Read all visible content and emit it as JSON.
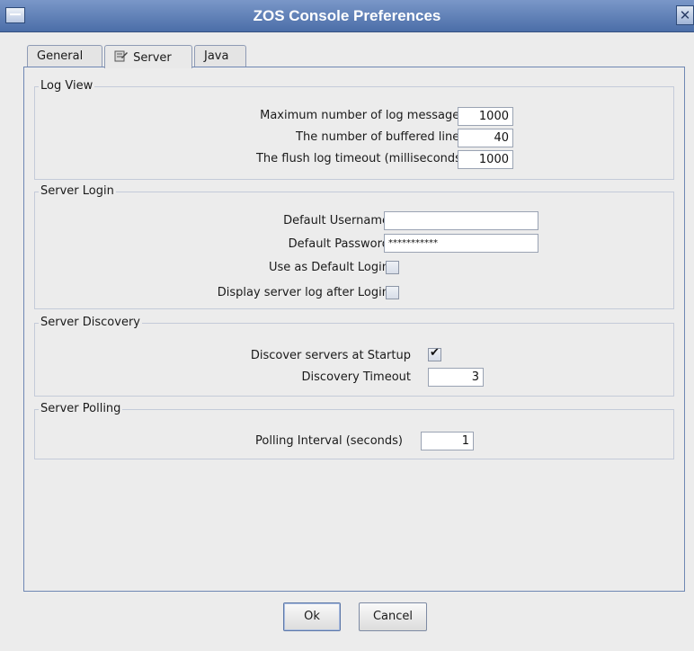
{
  "window": {
    "title": "ZOS Console Preferences",
    "close_glyph": "✕",
    "menu_icon": "window-menu-icon"
  },
  "tabs": [
    {
      "label": "General",
      "active": false
    },
    {
      "label": "Server",
      "active": true,
      "icon": "server-tab-icon"
    },
    {
      "label": "Java",
      "active": false
    }
  ],
  "log_view": {
    "title": "Log View",
    "max_messages_label": "Maximum number of log messages",
    "max_messages_value": "1000",
    "buffered_lines_label": "The number of buffered lines",
    "buffered_lines_value": "40",
    "flush_timeout_label": "The flush log timeout (milliseconds)",
    "flush_timeout_value": "1000"
  },
  "server_login": {
    "title": "Server Login",
    "username_label": "Default Username",
    "username_value": "",
    "password_label": "Default Password",
    "password_value": "***********",
    "default_login_label": "Use as Default Login",
    "default_login_checked": false,
    "display_log_label": "Display server log after Login",
    "display_log_checked": false
  },
  "server_discovery": {
    "title": "Server Discovery",
    "discover_startup_label": "Discover servers at Startup",
    "discover_startup_checked": true,
    "timeout_label": "Discovery Timeout",
    "timeout_value": "3"
  },
  "server_polling": {
    "title": "Server Polling",
    "interval_label": "Polling Interval (seconds)",
    "interval_value": "1"
  },
  "buttons": {
    "ok_label": "Ok",
    "cancel_label": "Cancel"
  }
}
